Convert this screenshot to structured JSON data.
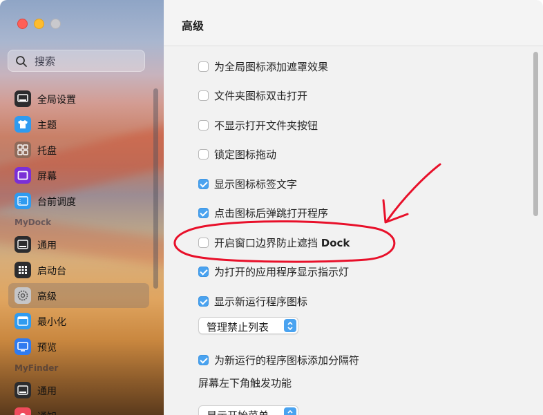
{
  "window": {
    "title": "高级"
  },
  "search": {
    "placeholder": "搜索"
  },
  "sidebar": {
    "items": [
      {
        "label": "全局设置",
        "icon": "monitor-icon"
      },
      {
        "label": "主题",
        "icon": "tshirt-icon"
      },
      {
        "label": "托盘",
        "icon": "grid-icon"
      },
      {
        "label": "屏幕",
        "icon": "screen-icon"
      },
      {
        "label": "台前调度",
        "icon": "stage-manager-icon"
      }
    ],
    "section_mydock": "MyDock",
    "mydock_items": [
      {
        "label": "通用",
        "icon": "dock-icon"
      },
      {
        "label": "启动台",
        "icon": "launchpad-icon"
      },
      {
        "label": "高级",
        "icon": "gear-icon",
        "selected": true
      },
      {
        "label": "最小化",
        "icon": "minimize-icon"
      },
      {
        "label": "预览",
        "icon": "preview-icon"
      }
    ],
    "section_myfinder": "MyFinder",
    "myfinder_items": [
      {
        "label": "通用",
        "icon": "dock-icon"
      },
      {
        "label": "通知",
        "icon": "notification-icon"
      }
    ]
  },
  "settings": [
    {
      "label": "为全局图标添加遮罩效果",
      "checked": false
    },
    {
      "label": "文件夹图标双击打开",
      "checked": false
    },
    {
      "label": "不显示打开文件夹按钮",
      "checked": false
    },
    {
      "label": "锁定图标拖动",
      "checked": false
    },
    {
      "label": "显示图标标签文字",
      "checked": true
    },
    {
      "label": "点击图标后弹跳打开程序",
      "checked": true
    },
    {
      "label": "开启窗口边界防止遮挡 ",
      "label_bold": "Dock",
      "checked": false
    },
    {
      "label": "为打开的应用程序显示指示灯",
      "checked": true
    },
    {
      "label": "显示新运行程序图标",
      "checked": true
    }
  ],
  "popup_blocklist": "管理禁止列表",
  "setting_separator": {
    "label": "为新运行的程序图标添加分隔符",
    "checked": true
  },
  "hot_corner_label": "屏幕左下角触发功能",
  "popup_hot_corner": "显示开始菜单",
  "colors": {
    "accent": "#4aa3f0",
    "annotation": "#e8102a"
  }
}
